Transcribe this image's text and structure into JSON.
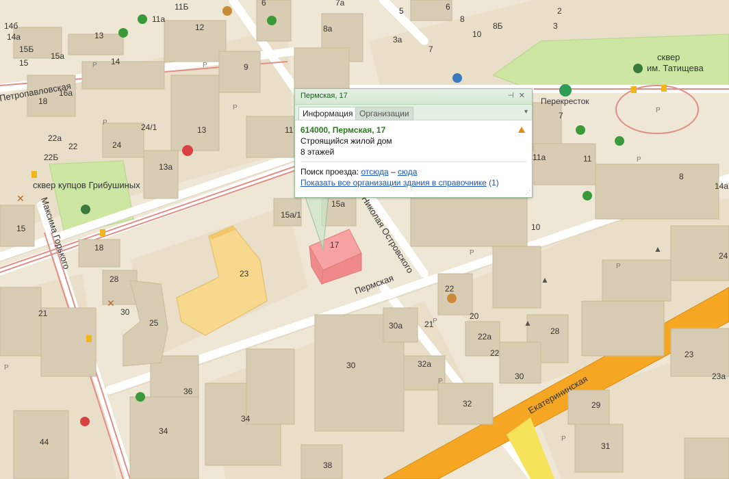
{
  "popup": {
    "title": "Пермская, 17",
    "tabs": [
      "Информация",
      "Организации"
    ],
    "postal_address": "614000, Пермская, 17",
    "building_status": "Строящийся жилой дом",
    "floors": "8 этажей",
    "route_label": "Поиск проезда:",
    "route_from": "отсюда",
    "route_dash": "–",
    "route_to": "сюда",
    "show_orgs_link": "Показать все организации здания в справочнике",
    "orgs_count": "(1)",
    "pin_icon": "pin-icon",
    "close_icon": "close-icon",
    "warning_icon": "warning-icon",
    "warning_color": "#e08a1a"
  },
  "streets": {
    "permskaya": "Пермская",
    "ekaterininskaya": "Екатерининская",
    "nikolaya_ostrovskogo": "Николая Островского",
    "maksima_gorkogo": "Максима Горького",
    "petropavlovskaya": "Петропавловская"
  },
  "places": {
    "skver_grib": "сквер купцов Грибушиных",
    "skver_tat_1": "сквер",
    "skver_tat_2": "им. Татищева",
    "perekrestok": "Перекресток"
  },
  "house_numbers": [
    "14б",
    "14а",
    "15Б",
    "15",
    "13",
    "11а",
    "12",
    "11Б",
    "6",
    "7а",
    "5",
    "6",
    "8",
    "2",
    "8а",
    "3а",
    "7",
    "10",
    "8Б",
    "3",
    "15а",
    "14",
    "16а",
    "18",
    "9",
    "22а",
    "22",
    "22Б",
    "24",
    "24/1",
    "13",
    "13а",
    "11",
    "7",
    "15",
    "18",
    "28",
    "30",
    "25",
    "21",
    "23",
    "15а/1",
    "15а",
    "17",
    "11а",
    "11",
    "8",
    "14а",
    "10",
    "24",
    "20",
    "22",
    "21",
    "30а",
    "32а",
    "22а",
    "22",
    "30",
    "28",
    "23",
    "23а",
    "29",
    "30",
    "32",
    "36",
    "34",
    "34",
    "44",
    "38",
    "31"
  ],
  "map_icons": [
    "park-icon",
    "restaurant-icon",
    "bus-stop-icon",
    "hospital-icon",
    "bank-icon",
    "fuel-icon",
    "shop-icon",
    "cafe-icon",
    "museum-icon",
    "school-icon",
    "parking-icon"
  ],
  "parking_label": "P",
  "colors": {
    "highlighted_building": "#f08a8a",
    "construction_building": "#f7d88c",
    "main_road": "#f5a623",
    "secondary_road": "#ffffff",
    "park": "#cde7a3",
    "tram_line": "#e08e86"
  }
}
